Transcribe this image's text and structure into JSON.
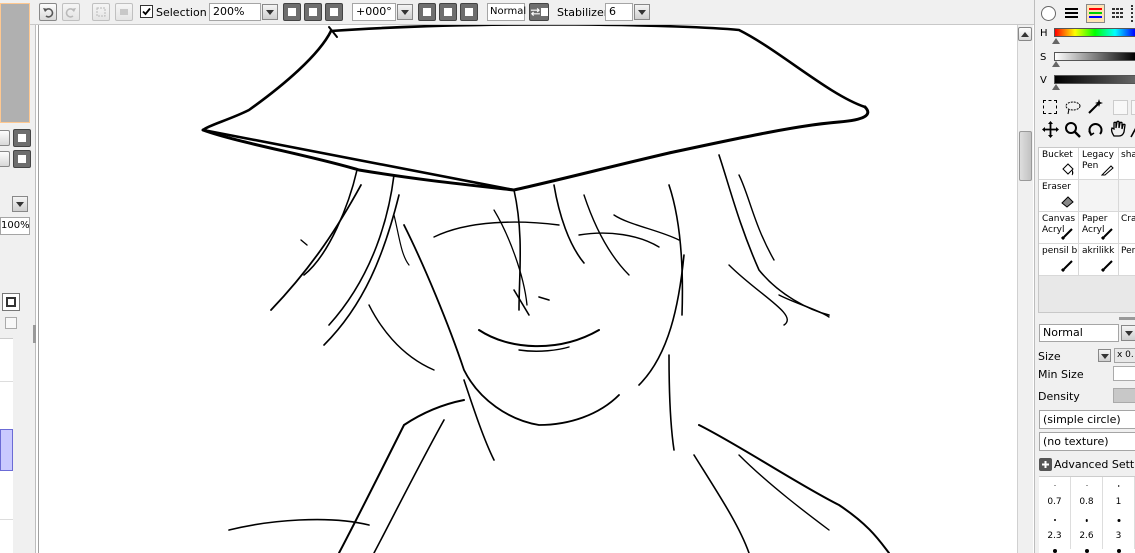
{
  "toolbar": {
    "selection_label": "Selection",
    "selection_checked": true,
    "zoom_value": "200%",
    "rotation_value": "+000°",
    "blend_mode": "Normal",
    "stabilizer_label": "Stabilizer",
    "stabilizer_value": "6"
  },
  "left_panel": {
    "opacity_value": "100%"
  },
  "right_panel": {
    "color_sliders": [
      "H",
      "S",
      "V"
    ],
    "tools": [
      {
        "label": "Bucket",
        "icon": "bucket-icon"
      },
      {
        "label": "Legacy\nPen",
        "icon": "pen-icon"
      },
      {
        "label": "sha",
        "icon": ""
      },
      {
        "label": "Eraser",
        "icon": "eraser-icon"
      },
      {
        "label": "",
        "icon": ""
      },
      {
        "label": "",
        "icon": ""
      },
      {
        "label": "Canvas\nAcryl",
        "icon": "brush-icon"
      },
      {
        "label": "Paper\nAcryl",
        "icon": "brush-icon"
      },
      {
        "label": "Cra",
        "icon": ""
      },
      {
        "label": "pensil bri",
        "icon": "brush-icon"
      },
      {
        "label": "akrilikk",
        "icon": "brush-icon"
      },
      {
        "label": "Pen",
        "icon": ""
      }
    ],
    "blend_mode": "Normal",
    "size_label": "Size",
    "size_multiplier": "x 0.",
    "min_size_label": "Min Size",
    "density_label": "Density",
    "shape_value": "(simple circle)",
    "texture_value": "(no texture)",
    "advanced_label": "Advanced Setting",
    "brush_sizes_row1": [
      "0.7",
      "0.8",
      "1"
    ],
    "brush_sizes_row2": [
      "2.3",
      "2.6",
      "3"
    ],
    "colors": {
      "accent": "#ffc890",
      "hue_red": "#ff0000",
      "layer_selected": "#c9c9ff"
    }
  }
}
